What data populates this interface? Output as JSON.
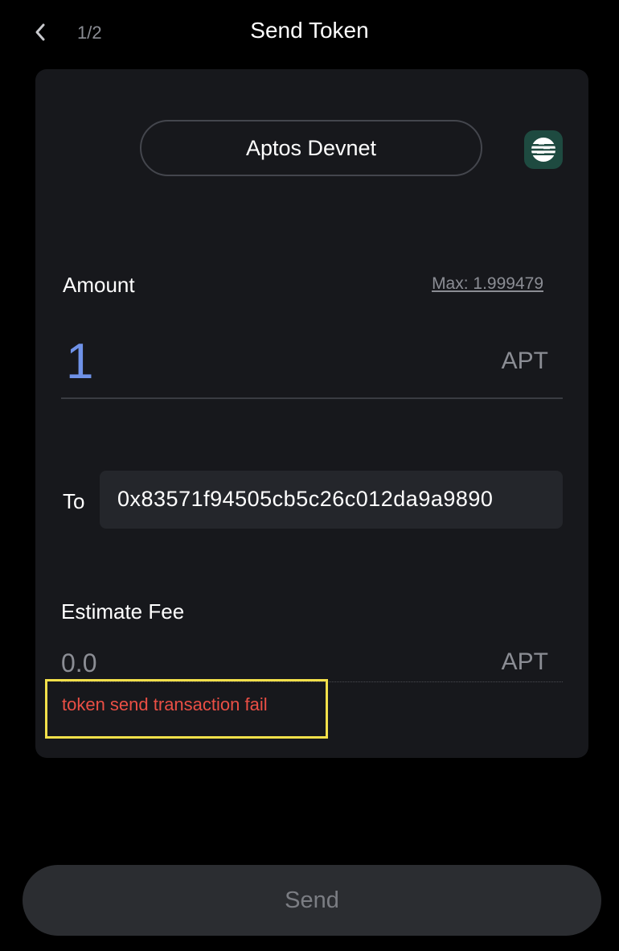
{
  "header": {
    "step": "1/2",
    "title": "Send Token"
  },
  "network": {
    "name": "Aptos Devnet",
    "logo_icon": "aptos-logo-icon",
    "logo_color": "#1e4a40"
  },
  "amount": {
    "label": "Amount",
    "max_label": "Max: 1.999479",
    "value": "1",
    "unit": "APT"
  },
  "recipient": {
    "label": "To",
    "address": "0x83571f94505cb5c26c012da9a9890"
  },
  "fee": {
    "label": "Estimate Fee",
    "value": "0.0",
    "unit": "APT"
  },
  "error": {
    "message": "token send transaction fail",
    "color": "#ea4f45"
  },
  "actions": {
    "send_label": "Send"
  },
  "colors": {
    "background": "#000000",
    "card": "#17181c",
    "accent_amount": "#6f92e8",
    "highlight_border": "#f3e04a"
  }
}
